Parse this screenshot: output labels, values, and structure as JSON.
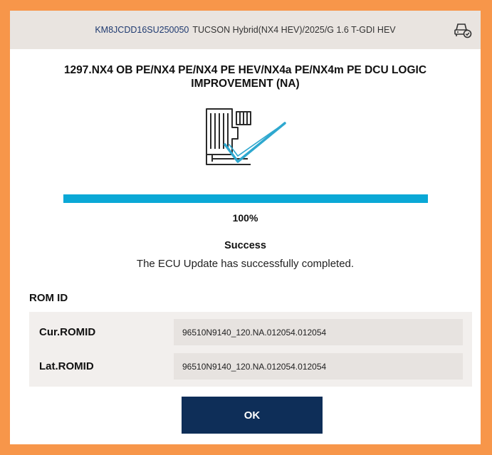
{
  "header": {
    "vin": "KM8JCDD16SU250050",
    "vehicle": "TUCSON Hybrid(NX4 HEV)/2025/G 1.6 T-GDI HEV",
    "icon": "car-check-icon"
  },
  "title": "1297.NX4 OB PE/NX4 PE/NX4 PE HEV/NX4a PE/NX4m PE DCU LOGIC IMPROVEMENT (NA)",
  "illustration": "ecu-success-icon",
  "progress": {
    "value": 100,
    "label": "100%"
  },
  "status": "Success",
  "message": "The ECU Update has successfully completed.",
  "rom": {
    "heading": "ROM ID",
    "rows": [
      {
        "label": "Cur.ROMID",
        "value": "96510N9140_120.NA.012054.012054"
      },
      {
        "label": "Lat.ROMID",
        "value": "96510N9140_120.NA.012054.012054"
      }
    ]
  },
  "ok_label": "OK",
  "colors": {
    "frame": "#f7964a",
    "header_bg": "#e9e4e0",
    "vin": "#1f3a70",
    "progress": "#0aa8d6",
    "button": "#0e2e58",
    "check": "#2ea8cf"
  }
}
